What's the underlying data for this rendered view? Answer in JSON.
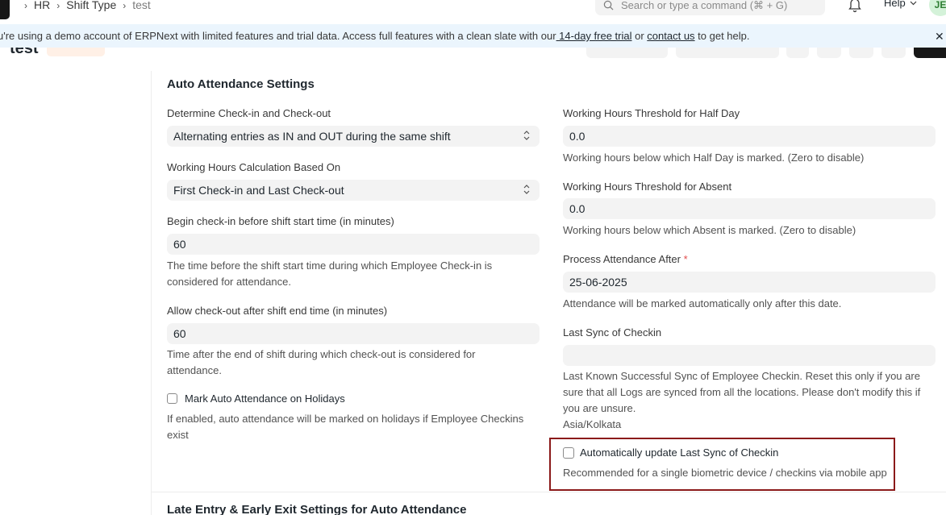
{
  "navbar": {
    "breadcrumbs": [
      "HR",
      "Shift Type",
      "test"
    ],
    "search_placeholder": "Search or type a command (⌘ + G)",
    "help_label": "Help",
    "avatar_initials": "JE"
  },
  "banner": {
    "text_before": "u're using a demo account of ERPNext with limited features and trial data. Access full features with a clean slate with our",
    "link1": " 14-day free trial",
    "text_mid": " or ",
    "link2": "contact us",
    "text_after": " to get help.",
    "close": "✕"
  },
  "page_head": {
    "title": "test"
  },
  "form": {
    "section_title": "Auto Attendance Settings",
    "left": {
      "determine_label": "Determine Check-in and Check-out",
      "determine_value": "Alternating entries as IN and OUT during the same shift",
      "calc_label": "Working Hours Calculation Based On",
      "calc_value": "First Check-in and Last Check-out",
      "begin_label": "Begin check-in before shift start time (in minutes)",
      "begin_value": "60",
      "begin_desc": "The time before the shift start time during which Employee Check-in is considered for attendance.",
      "allow_label": "Allow check-out after shift end time (in minutes)",
      "allow_value": "60",
      "allow_desc": "Time after the end of shift during which check-out is considered for attendance.",
      "holiday_label": "Mark Auto Attendance on Holidays",
      "holiday_desc": "If enabled, auto attendance will be marked on holidays if Employee Checkins exist"
    },
    "right": {
      "half_label": "Working Hours Threshold for Half Day",
      "half_value": "0.0",
      "half_desc": "Working hours below which Half Day is marked. (Zero to disable)",
      "absent_label": "Working Hours Threshold for Absent",
      "absent_value": "0.0",
      "absent_desc": "Working hours below which Absent is marked. (Zero to disable)",
      "process_label": "Process Attendance After",
      "process_required": "*",
      "process_value": "25-06-2025",
      "process_desc": "Attendance will be marked automatically only after this date.",
      "sync_label": "Last Sync of Checkin",
      "sync_value": "",
      "sync_desc": "Last Known Successful Sync of Employee Checkin. Reset this only if you are sure that all Logs are synced from all the locations. Please don't modify this if you are unsure.",
      "timezone": "Asia/Kolkata",
      "auto_update_label": "Automatically update Last Sync of Checkin",
      "auto_update_desc": "Recommended for a single biometric device / checkins via mobile app"
    },
    "next_section_title": "Late Entry & Early Exit Settings for Auto Attendance"
  }
}
